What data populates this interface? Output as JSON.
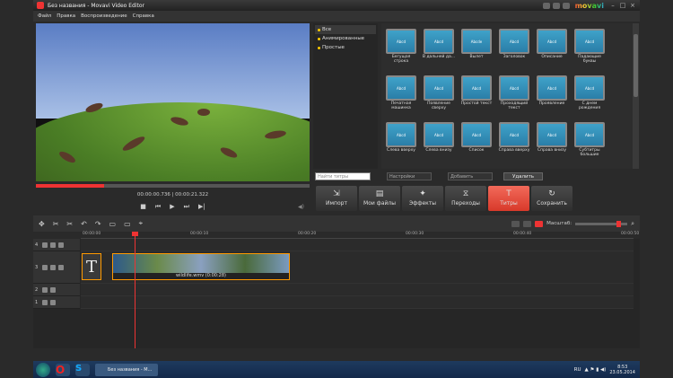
{
  "window": {
    "title": "Без названия - Movavi Video Editor",
    "brand": "movavi"
  },
  "menu": [
    "Файл",
    "Правка",
    "Воспроизведение",
    "Справка"
  ],
  "player": {
    "timecode": "00:00:00.736 | 00:00:21.322",
    "progress_fraction": 0.25
  },
  "categories": [
    {
      "label": "Все",
      "selected": true
    },
    {
      "label": "Анимированные",
      "selected": false
    },
    {
      "label": "Простые",
      "selected": false
    }
  ],
  "title_styles": [
    {
      "label": "Бегущая строка",
      "thumb": "Abcd"
    },
    {
      "label": "В дальней да...",
      "thumb": "Abcd"
    },
    {
      "label": "Вылет",
      "thumb": "Abcde"
    },
    {
      "label": "Заголовок",
      "thumb": "Abcd"
    },
    {
      "label": "Описание",
      "thumb": "Abcd"
    },
    {
      "label": "Падающие буквы",
      "thumb": "Abcd"
    },
    {
      "label": "Печатная машинка",
      "thumb": "Abcd"
    },
    {
      "label": "Появление сверху",
      "thumb": "Abcd"
    },
    {
      "label": "Простой текст",
      "thumb": "Abcd"
    },
    {
      "label": "Проходящий текст",
      "thumb": "Abcd"
    },
    {
      "label": "Проявление",
      "thumb": "Abcd"
    },
    {
      "label": "С днем рождения",
      "thumb": "Abcd"
    },
    {
      "label": "Слева вверху",
      "thumb": "Abcd"
    },
    {
      "label": "Слева внизу",
      "thumb": "Abcd"
    },
    {
      "label": "Список",
      "thumb": "Abcd"
    },
    {
      "label": "Справа вверху",
      "thumb": "Abcd"
    },
    {
      "label": "Справа внизу",
      "thumb": "Abcd"
    },
    {
      "label": "Субтитры большие",
      "thumb": "Abcd"
    }
  ],
  "search": {
    "placeholder": "Найти титры",
    "settings_label": "Настройки",
    "add_label": "Добавить",
    "delete_label": "Удалить"
  },
  "tabs": [
    {
      "label": "Импорт",
      "icon": "import-icon",
      "glyph": "⇲"
    },
    {
      "label": "Мои файлы",
      "icon": "files-icon",
      "glyph": "▤"
    },
    {
      "label": "Эффекты",
      "icon": "effects-icon",
      "glyph": "✦"
    },
    {
      "label": "Переходы",
      "icon": "transitions-icon",
      "glyph": "⧖"
    },
    {
      "label": "Титры",
      "icon": "titles-icon",
      "glyph": "T",
      "active": true
    },
    {
      "label": "Сохранить",
      "icon": "save-icon",
      "glyph": "↻"
    }
  ],
  "toolbar": {
    "zoom_label": "Масштаб:",
    "tools": [
      "✥",
      "✂",
      "✂",
      "↶",
      "↷",
      "▭",
      "▭",
      "⌖"
    ]
  },
  "ruler": [
    "00:00:00",
    "00:00:10",
    "00:00:20",
    "00:00:30",
    "00:00:40",
    "00:00:50"
  ],
  "tracks": [
    "4",
    "3",
    "2",
    "1"
  ],
  "clip": {
    "name": "wildlife.wmv (0:00:28)",
    "title_letter": "T"
  },
  "taskbar": {
    "task_label": "Без названия - M...",
    "lang": "RU",
    "time": "8:53",
    "date": "23.05.2014"
  }
}
